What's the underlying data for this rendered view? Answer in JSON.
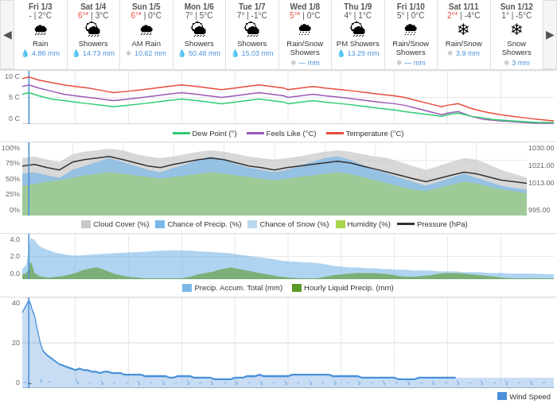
{
  "nav": {
    "prev": "◀",
    "next": "▶"
  },
  "days": [
    {
      "id": "fri-1-3",
      "name": "Fri 1/3",
      "temp_high": "-",
      "temp_low": "2°C",
      "star": false,
      "icon": "🌧",
      "label": "Rain",
      "precip_icon": "💧",
      "precip": "4.86 mm"
    },
    {
      "id": "sat-1-4",
      "name": "Sat 1/4",
      "temp_high": "6°*",
      "temp_low": "3°C",
      "star": true,
      "icon": "🌦",
      "label": "Showers",
      "precip_icon": "💧",
      "precip": "14.73 mm"
    },
    {
      "id": "sun-1-5",
      "name": "Sun 1/5",
      "temp_high": "6°*",
      "temp_low": "0°C",
      "star": true,
      "icon": "🌧",
      "label": "AM Rain",
      "precip_icon": "❄",
      "precip": "10.62 mm"
    },
    {
      "id": "mon-1-6",
      "name": "Mon 1/6",
      "temp_high": "7°",
      "temp_low": "5°C",
      "star": false,
      "icon": "🌦",
      "label": "Showers",
      "precip_icon": "💧",
      "precip": "50.48 mm"
    },
    {
      "id": "tue-1-7",
      "name": "Tue 1/7",
      "temp_high": "7°",
      "temp_low": "-1°C",
      "star": false,
      "icon": "🌦",
      "label": "Showers",
      "precip_icon": "💧",
      "precip": "15.03 mm"
    },
    {
      "id": "wed-1-8",
      "name": "Wed 1/8",
      "temp_high": "5°*",
      "temp_low": "0°C",
      "star": true,
      "icon": "🌨",
      "label": "Rain/Snow\nShowers",
      "precip_icon": "❄",
      "precip": "— mm"
    },
    {
      "id": "thu-1-9",
      "name": "Thu 1/9",
      "temp_high": "4°",
      "temp_low": "1°C",
      "star": false,
      "icon": "🌦",
      "label": "PM Showers",
      "precip_icon": "💧",
      "precip": "13.29 mm"
    },
    {
      "id": "fri-1-10",
      "name": "Fri 1/10",
      "temp_high": "5°",
      "temp_low": "0°C",
      "star": false,
      "icon": "🌨",
      "label": "Rain/Snow\nShowers",
      "precip_icon": "❄",
      "precip": "— mm"
    },
    {
      "id": "sat-1-11",
      "name": "Sat 1/11",
      "temp_high": "2°*",
      "temp_low": "-4°C",
      "star": true,
      "icon": "❄",
      "label": "Rain/Snow",
      "precip_icon": "❄",
      "precip": "3.9 mm"
    },
    {
      "id": "sun-1-12",
      "name": "Sun 1/12",
      "temp_high": "1°",
      "temp_low": "-5°C",
      "star": false,
      "icon": "❄",
      "label": "Snow Showers",
      "precip_icon": "❄",
      "precip": "3 mm"
    }
  ],
  "legend_temp": [
    {
      "id": "dew-point",
      "label": "Dew Point (°)",
      "color": "#2ecc71"
    },
    {
      "id": "feels-like",
      "label": "Feels Like (°C)",
      "color": "#9b59b6"
    },
    {
      "id": "temperature",
      "label": "Temperature (°C)",
      "color": "#e74c3c"
    }
  ],
  "legend_precip_pct": [
    {
      "id": "cloud-cover",
      "label": "Cloud Cover (%)",
      "color": "#aaa",
      "type": "area"
    },
    {
      "id": "chance-precip",
      "label": "Chance of Precip. (%)",
      "color": "#7ab8e8",
      "type": "area"
    },
    {
      "id": "chance-snow",
      "label": "Chance of Snow (%)",
      "color": "#b8d8f0",
      "type": "area"
    },
    {
      "id": "humidity",
      "label": "Humidity (%)",
      "color": "#a8d44e",
      "type": "area"
    },
    {
      "id": "pressure",
      "label": "Pressure  (hPa)",
      "color": "#333",
      "type": "line"
    }
  ],
  "legend_precip_amt": [
    {
      "id": "precip-accum",
      "label": "Precip. Accum. Total (mm)",
      "color": "#7ab8e8",
      "type": "area"
    },
    {
      "id": "hourly-liquid",
      "label": "Hourly Liquid Precip. (mm)",
      "color": "#5a9a28",
      "type": "area"
    }
  ],
  "legend_wind": [
    {
      "id": "wind-speed",
      "label": "Wind Speed",
      "color": "#4a90d9"
    }
  ],
  "y_temp": [
    "10 C",
    "5 C",
    "0 C"
  ],
  "y_precip_pct": [
    "100%",
    "75%",
    "50%",
    "25%",
    "0%"
  ],
  "y_precip_pct_right": [
    "1030.00",
    "1021.00",
    "1013.00",
    "",
    "995.00"
  ],
  "y_precip_amt": [
    "4.0",
    "2.0",
    "0.0"
  ],
  "y_wind": [
    "40",
    "20",
    "0"
  ]
}
